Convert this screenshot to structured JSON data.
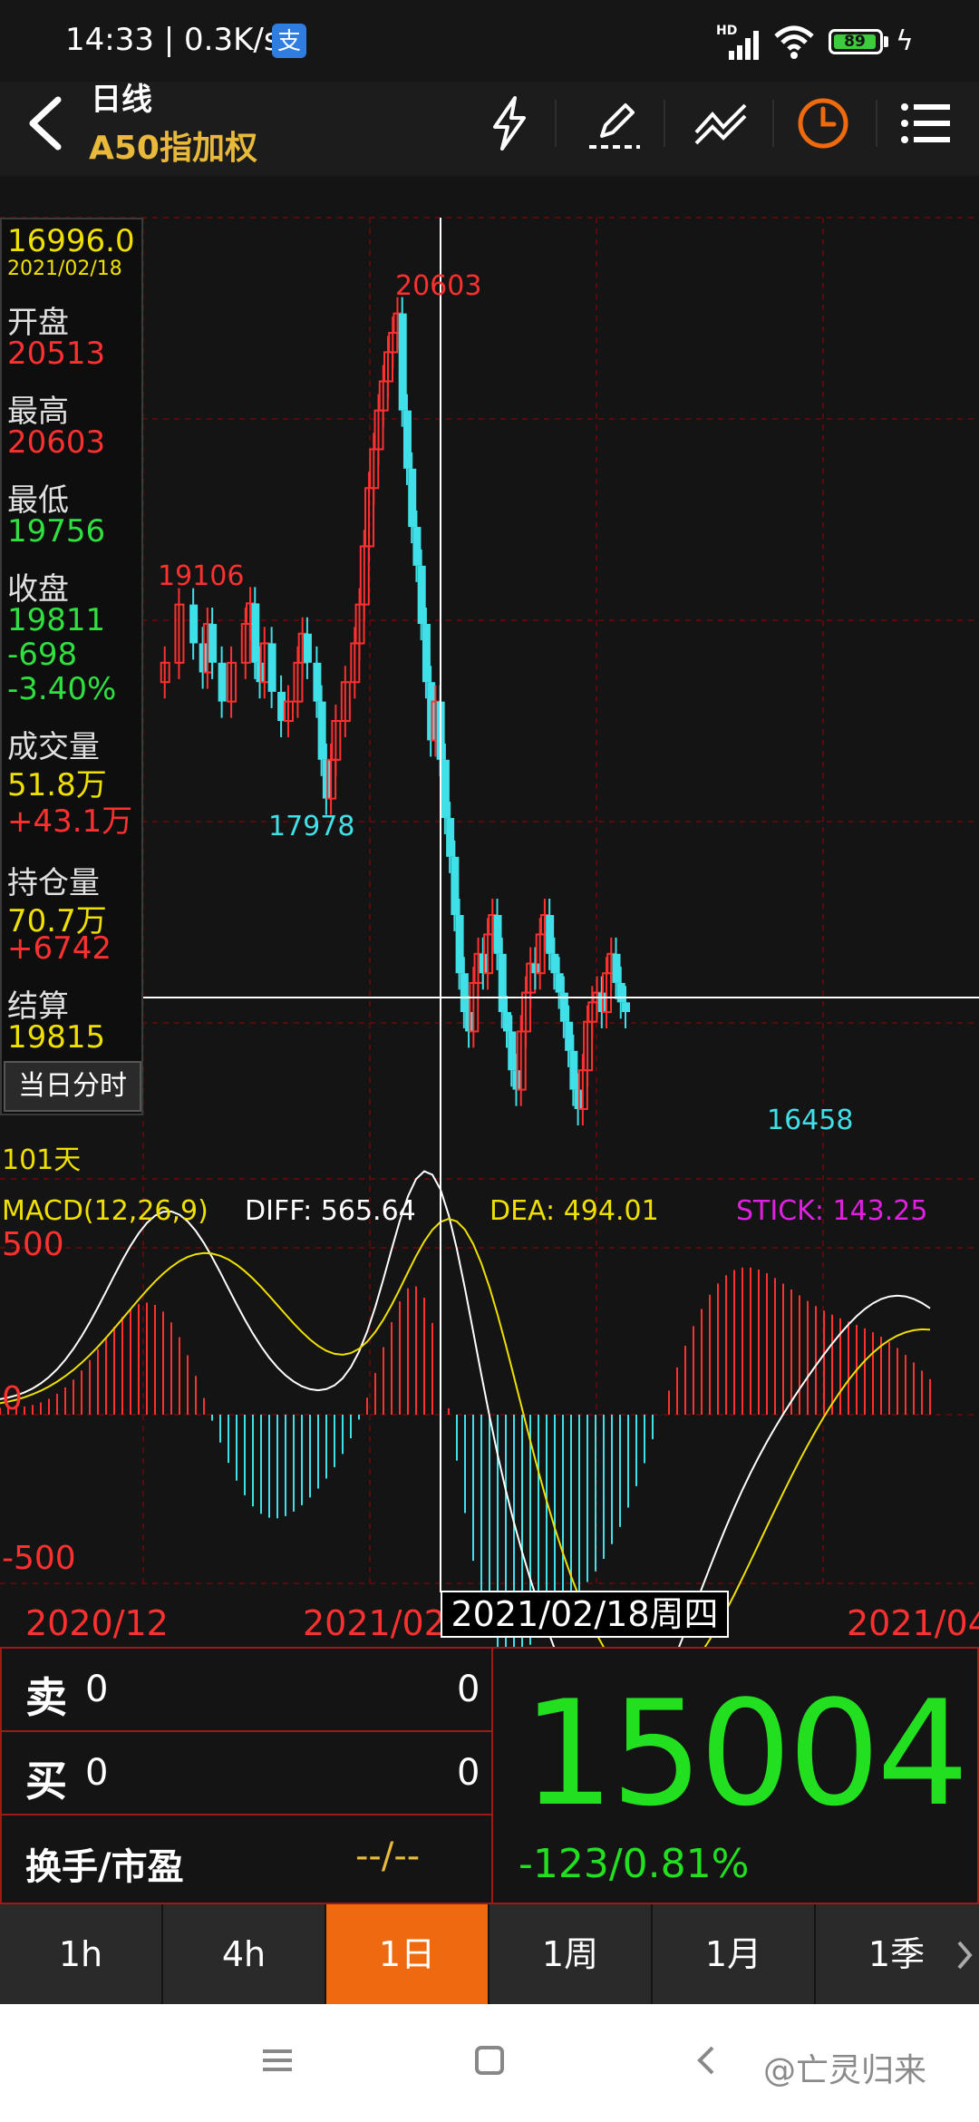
{
  "status_bar": {
    "time_speed": "14:33 | 0.3K/s",
    "pay_badge": "支",
    "hd": "HD",
    "battery": "89"
  },
  "header": {
    "title": "日线",
    "subtitle": "A50指加权"
  },
  "chart": {
    "top_price_label": "20603",
    "label_19106": "19106",
    "label_17978": "17978",
    "label_16458": "16458",
    "days_label": "101天",
    "macd_name": "MACD(12,26,9)",
    "diff": "DIFF: 565.64",
    "dea": "DEA: 494.01",
    "stick": "STICK: 143.25",
    "macd_top": "500",
    "macd_zero": "0",
    "macd_bottom": "-500",
    "date_left": "2020/12",
    "date_mid": "2021/02",
    "date_right": "2021/04",
    "cross_date": "2021/02/18周四",
    "colors": {
      "up": "#ff3030",
      "down": "#3fe0e8",
      "diff_line": "#ffffff",
      "dea_line": "#f0e000",
      "grid": "#5a0a0a"
    }
  },
  "info_panel": {
    "price": "16996.0",
    "date": "2021/02/18",
    "open_label": "开盘",
    "open": "20513",
    "high_label": "最高",
    "high": "20603",
    "low_label": "最低",
    "low": "19756",
    "close_label": "收盘",
    "close": "19811",
    "change": "-698",
    "change_pct": "-3.40%",
    "vol_label": "成交量",
    "vol": "51.8万",
    "vol_change": "+43.1万",
    "oi_label": "持仓量",
    "oi": "70.7万",
    "oi_change": "+6742",
    "settle_label": "结算",
    "settle": "19815",
    "intraday_button": "当日分时"
  },
  "quote": {
    "sell_label": "卖",
    "sell_price": "0",
    "sell_qty": "0",
    "buy_label": "买",
    "buy_price": "0",
    "buy_qty": "0",
    "turnover_label": "换手/市盈",
    "turnover_value": "--/--",
    "last_price": "15004",
    "price_change": "-123/0.81%"
  },
  "tabs": [
    "1h",
    "4h",
    "1日",
    "1周",
    "1月",
    "1季"
  ],
  "active_tab": "1日",
  "nav": {
    "watermark": "@亡灵归来"
  }
}
